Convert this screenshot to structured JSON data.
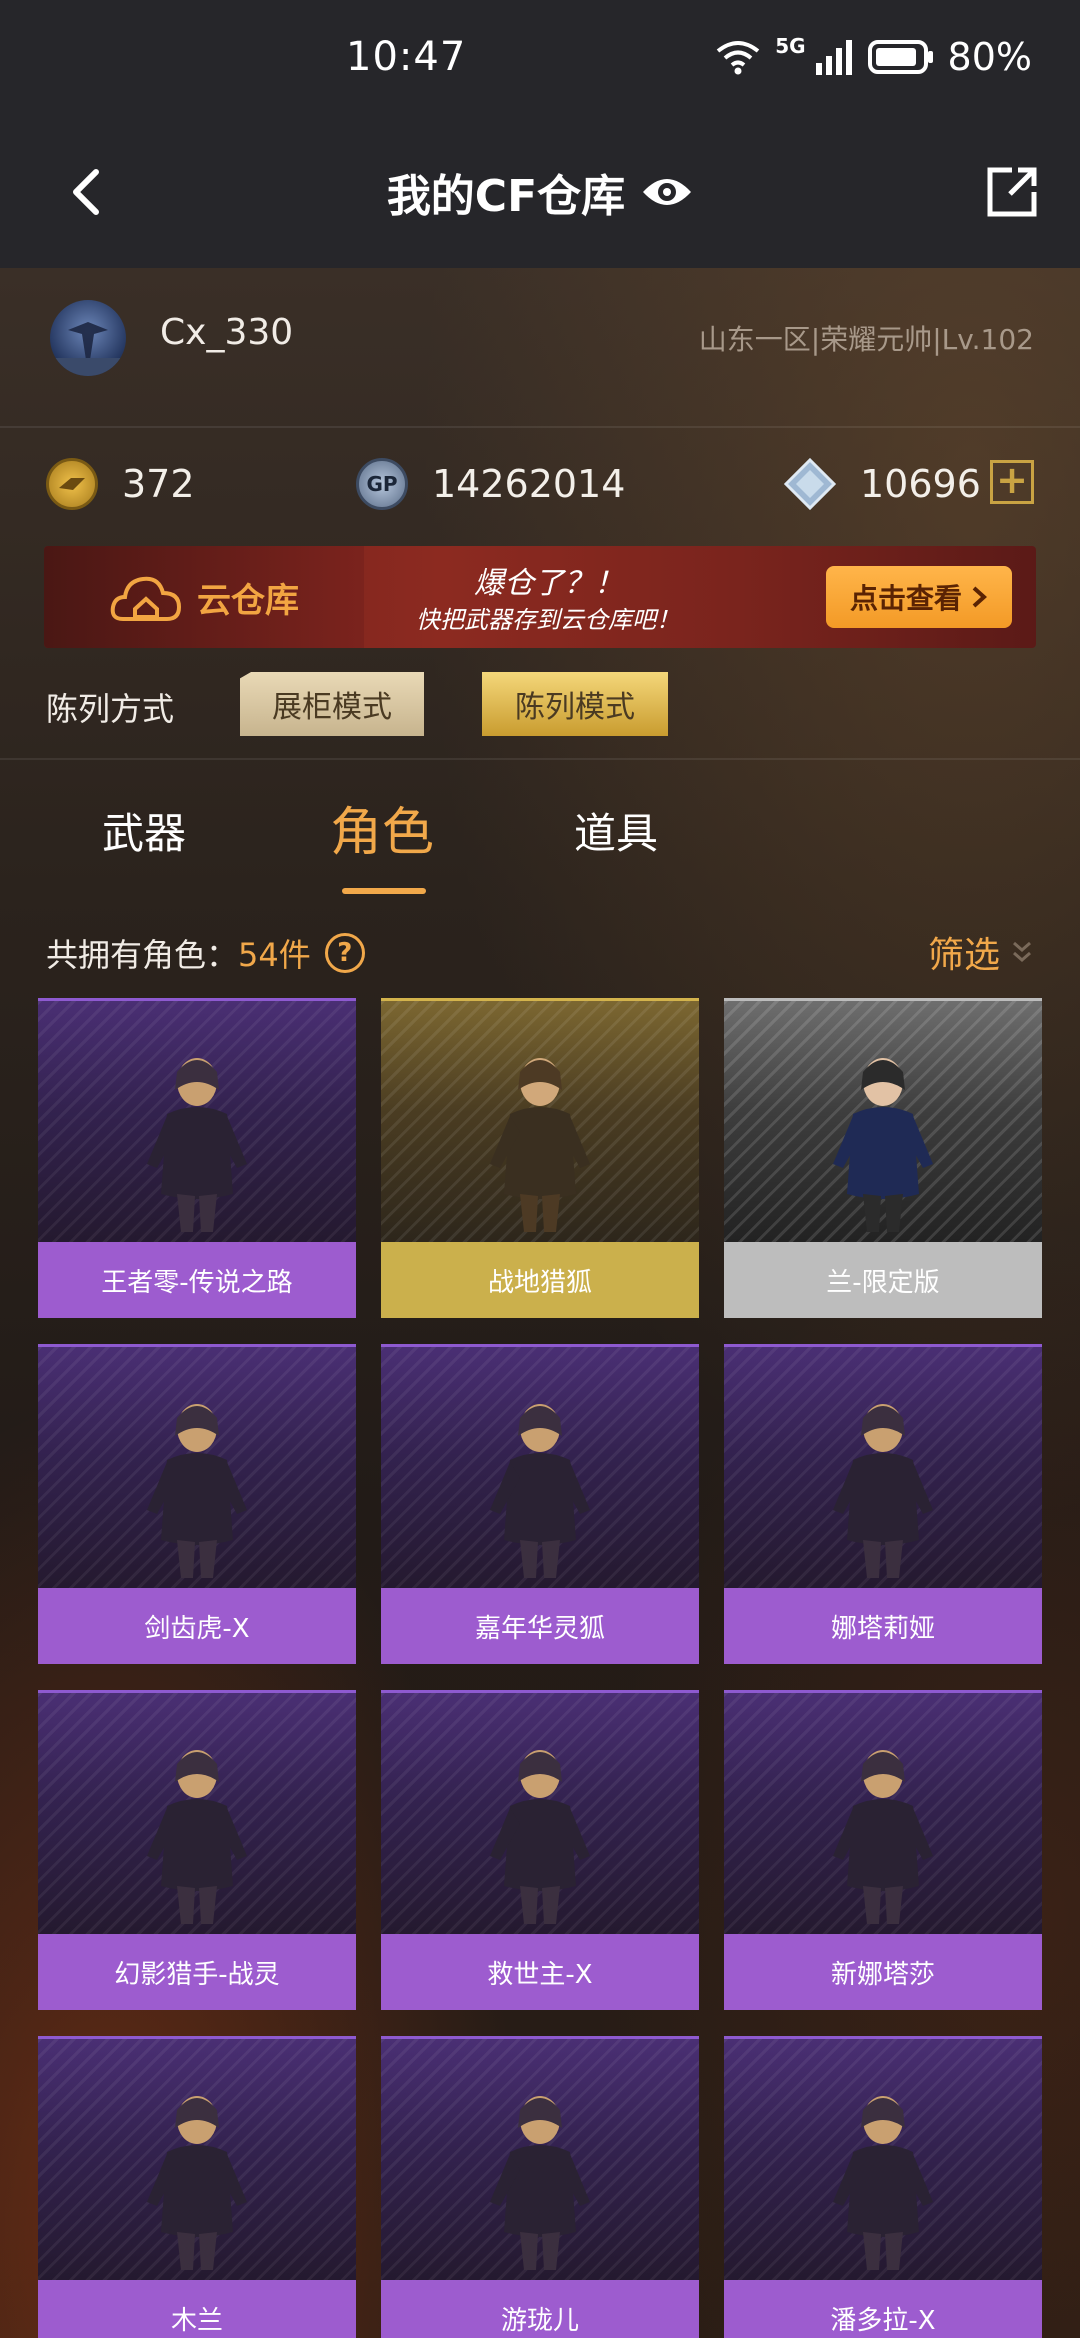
{
  "status_bar": {
    "time": "10:47",
    "network": "5G",
    "battery": "80%"
  },
  "header": {
    "title": "我的CF仓库",
    "icons": [
      "back-icon",
      "eye-icon",
      "share-icon"
    ]
  },
  "user": {
    "name": "Cx_330",
    "server_info": "山东一区|荣耀元帅|Lv.102"
  },
  "currencies": {
    "cf_points": "372",
    "gp": "14262014",
    "gp_icon_text": "GP",
    "diamonds": "10696"
  },
  "banner": {
    "cloud_label": "云仓库",
    "slogan_line1": "爆仓了？！",
    "slogan_line2": "快把武器存到云仓库吧！",
    "button_label": "点击查看"
  },
  "display_mode": {
    "label": "陈列方式",
    "cabinet": "展柜模式",
    "list": "陈列模式"
  },
  "tabs": [
    {
      "label": "武器",
      "active": false
    },
    {
      "label": "角色",
      "active": true
    },
    {
      "label": "道具",
      "active": false
    }
  ],
  "summary": {
    "prefix": "共拥有角色：",
    "count": "54件",
    "filter_label": "筛选"
  },
  "colors": {
    "accent": "#f1a84a",
    "purple_label": "#9d5ccf",
    "gold_label": "#cbb04c",
    "silver_label": "#bdbdbd"
  },
  "characters": [
    {
      "name": "王者零-传说之路",
      "tier": "purple"
    },
    {
      "name": "战地猎狐",
      "tier": "gold"
    },
    {
      "name": "兰-限定版",
      "tier": "silver"
    },
    {
      "name": "剑齿虎-X",
      "tier": "purple"
    },
    {
      "name": "嘉年华灵狐",
      "tier": "purple"
    },
    {
      "name": "娜塔莉娅",
      "tier": "purple"
    },
    {
      "name": "幻影猎手-战灵",
      "tier": "purple"
    },
    {
      "name": "救世主-X",
      "tier": "purple"
    },
    {
      "name": "新娜塔莎",
      "tier": "purple"
    },
    {
      "name": "木兰",
      "tier": "purple"
    },
    {
      "name": "游珑儿",
      "tier": "purple"
    },
    {
      "name": "潘多拉-X",
      "tier": "purple"
    }
  ]
}
